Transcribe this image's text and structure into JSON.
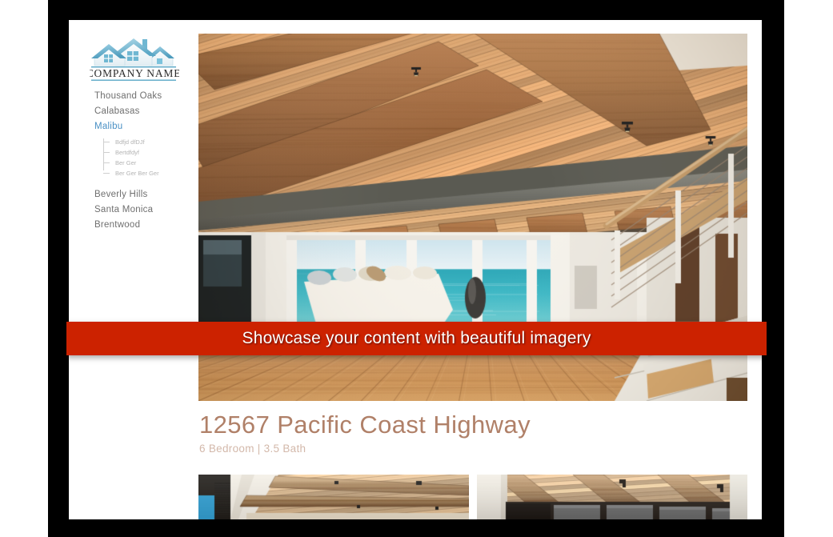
{
  "brand": {
    "logo_icon": "three-houses-icon",
    "company_name": "COMPANY NAME"
  },
  "sidebar": {
    "items": [
      {
        "label": "Thousand Oaks",
        "active": false
      },
      {
        "label": "Calabasas",
        "active": false
      },
      {
        "label": "Malibu",
        "active": true
      },
      {
        "label": "Beverly Hills",
        "active": false
      },
      {
        "label": "Santa Monica",
        "active": false
      },
      {
        "label": "Brentwood",
        "active": false
      }
    ],
    "subitems": [
      {
        "label": "Bdfjd dfDJf"
      },
      {
        "label": "Bertdfdyf"
      },
      {
        "label": "Ber Ger"
      },
      {
        "label": "Ber Ger  Ber Ger"
      }
    ]
  },
  "banner": {
    "text": "Showcase your content with beautiful imagery",
    "background_color": "#cc2200",
    "text_color": "#ffffff"
  },
  "listing": {
    "title": "12567 Pacific Coast Highway",
    "subtitle": "6 Bedroom | 3.5 Bath",
    "title_color": "#b08068",
    "subtitle_color": "#d3b8aa"
  },
  "hero": {
    "alt": "Modern beach house interior with exposed wood ceiling beams, open kitchen and ocean view"
  },
  "thumbnails": [
    {
      "alt": "Wood plank ceiling with recessed window wall"
    },
    {
      "alt": "Wood beam ceiling over dark glass wall"
    }
  ],
  "colors": {
    "accent_blue": "#4a90c4",
    "nav_text": "#6f6f6f",
    "subnav_text": "#b4b4b4",
    "frame": "#000000",
    "page": "#ffffff"
  }
}
